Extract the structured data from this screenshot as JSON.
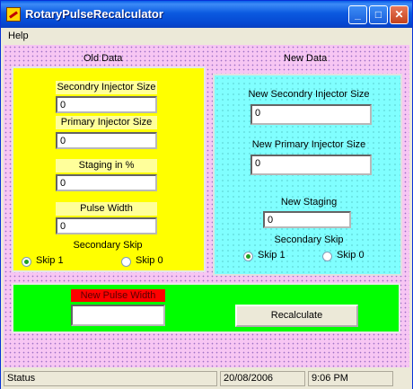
{
  "window": {
    "title": "RotaryPulseRecalculator"
  },
  "titlebar_buttons": {
    "minimize": "_",
    "maximize": "□",
    "close": "✕"
  },
  "menu": {
    "help": "Help"
  },
  "old_data": {
    "header": "Old Data",
    "secondary_injector_label": "Secondry Injector Size",
    "secondary_injector_value": "0",
    "primary_injector_label": "Primary Injector Size",
    "primary_injector_value": "0",
    "staging_label": "Staging in %",
    "staging_value": "0",
    "pulse_width_label": "Pulse Width",
    "pulse_width_value": "0",
    "secondary_skip_label": "Secondary Skip",
    "skip1_label": "Skip 1",
    "skip0_label": "Skip 0",
    "selected": "Skip 1"
  },
  "new_data": {
    "header": "New Data",
    "secondary_injector_label": "New Secondry Injector Size",
    "secondary_injector_value": "0",
    "primary_injector_label": "New Primary Injector Size",
    "primary_injector_value": "0",
    "staging_label": "New Staging",
    "staging_value": "0",
    "secondary_skip_label": "Secondary Skip",
    "skip1_label": "Skip 1",
    "skip0_label": "Skip 0",
    "selected": "Skip 1"
  },
  "result": {
    "new_pulse_width_label": "New Pulse Width",
    "new_pulse_width_value": "",
    "recalculate_button": "Recalculate"
  },
  "status_bar": {
    "status": "Status",
    "date": "20/08/2006",
    "time": "9:06 PM"
  },
  "colors": {
    "old_panel": "#ffff00",
    "new_panel": "#80ffff",
    "result_panel": "#00ff00",
    "pulse_label_bg": "#ff0000",
    "background": "#f7c6f3"
  }
}
